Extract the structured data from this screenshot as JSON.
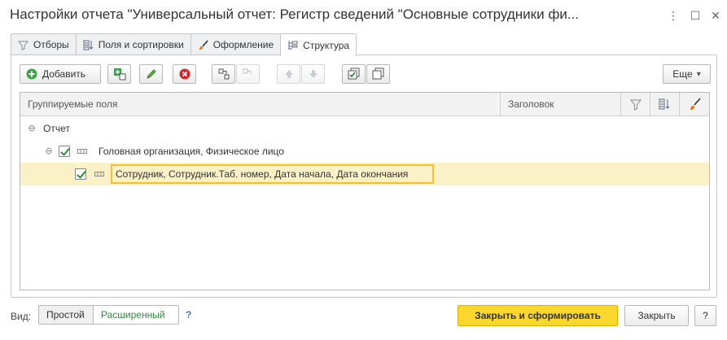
{
  "window": {
    "title": "Настройки отчета \"Универсальный отчет: Регистр сведений \"Основные сотрудники фи...",
    "more_icon": "⋮",
    "maximize_icon": "☐",
    "close_icon": "✕"
  },
  "tabs": [
    {
      "label": "Отборы",
      "icon": "filter-icon"
    },
    {
      "label": "Поля и сортировки",
      "icon": "fields-sort-icon"
    },
    {
      "label": "Оформление",
      "icon": "brush-icon"
    },
    {
      "label": "Структура",
      "icon": "structure-icon",
      "active": true
    }
  ],
  "toolbar": {
    "add_label": "Добавить",
    "more_label": "Еще",
    "more_arrow": "▾"
  },
  "grid": {
    "columns": {
      "grouped_fields": "Группируемые поля",
      "title": "Заголовок"
    },
    "rows": [
      {
        "label": "Отчет",
        "level": 0
      },
      {
        "label": "Головная организация, Физическое лицо",
        "level": 1,
        "checked": true
      },
      {
        "label": "Сотрудник, Сотрудник.Таб. номер, Дата начала, Дата окончания",
        "level": 2,
        "checked": true,
        "selected": true
      }
    ]
  },
  "footer": {
    "view_label": "Вид:",
    "view_simple": "Простой",
    "view_extended": "Расширенный",
    "help_q": "?",
    "close_and_build": "Закрыть и сформировать",
    "close": "Закрыть",
    "help": "?"
  },
  "colors": {
    "accent_yellow": "#fad72c",
    "selected_row": "#fbf1c6",
    "check_green": "#2e8b3c",
    "extended_green": "#2e8b3c"
  }
}
